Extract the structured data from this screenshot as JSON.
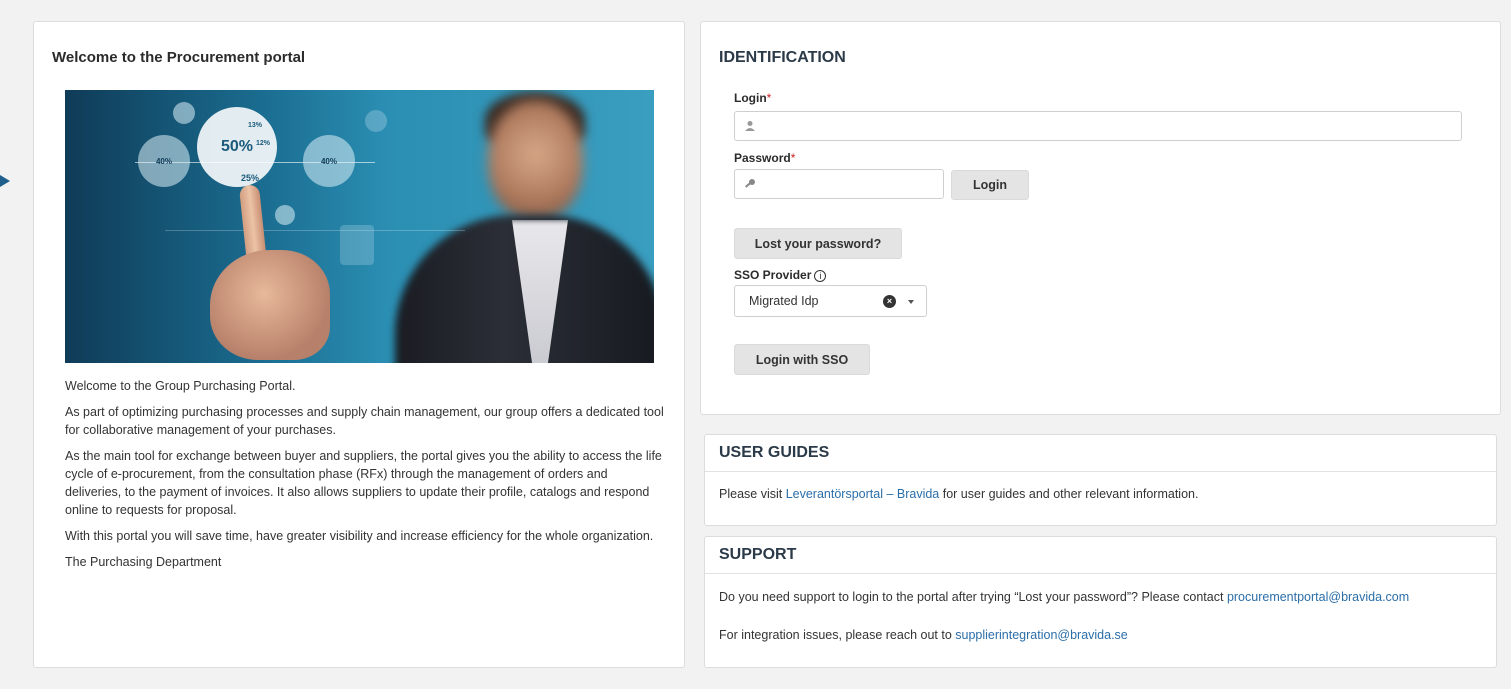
{
  "welcome": {
    "title": "Welcome to the Procurement portal",
    "hero_stats": [
      "50%",
      "13%",
      "12%",
      "25%",
      "40%",
      "40%",
      "25%"
    ],
    "paragraphs": [
      "Welcome to the Group Purchasing Portal.",
      "As part of optimizing purchasing processes and supply chain management, our group offers a dedicated tool for collaborative management of your purchases.",
      "As the main tool for exchange between buyer and suppliers, the portal gives you the ability to access the life cycle of e-procurement, from the consultation phase (RFx) through the management of orders and deliveries, to the payment of invoices. It also allows suppliers to update their profile, catalogs and respond online to requests for proposal.",
      "With this portal you will save time, have greater visibility and increase efficiency for the whole organization.",
      "The Purchasing Department"
    ]
  },
  "identification": {
    "title": "IDENTIFICATION",
    "login_label": "Login",
    "login_value": "",
    "password_label": "Password",
    "password_value": "",
    "required_mark": "*",
    "login_button": "Login",
    "lost_password_button": "Lost your password?",
    "sso_label": "SSO Provider",
    "sso_info": "i",
    "sso_selected": "Migrated Idp",
    "sso_button": "Login with SSO"
  },
  "user_guides": {
    "title": "USER GUIDES",
    "text_before": "Please visit ",
    "link": "Leverantörsportal – Bravida",
    "text_after": " for user guides and other relevant information."
  },
  "support": {
    "title": "SUPPORT",
    "line1_text": "Do you need support to login to the portal after trying “Lost your password”? Please contact ",
    "line1_link": "procurementportal@bravida.com",
    "line2_text": "For integration issues, please reach out to ",
    "line2_link": "supplierintegration@bravida.se"
  },
  "colors": {
    "link": "#2b6ea8",
    "required": "#d02020",
    "button_bg": "#e4e4e4"
  }
}
